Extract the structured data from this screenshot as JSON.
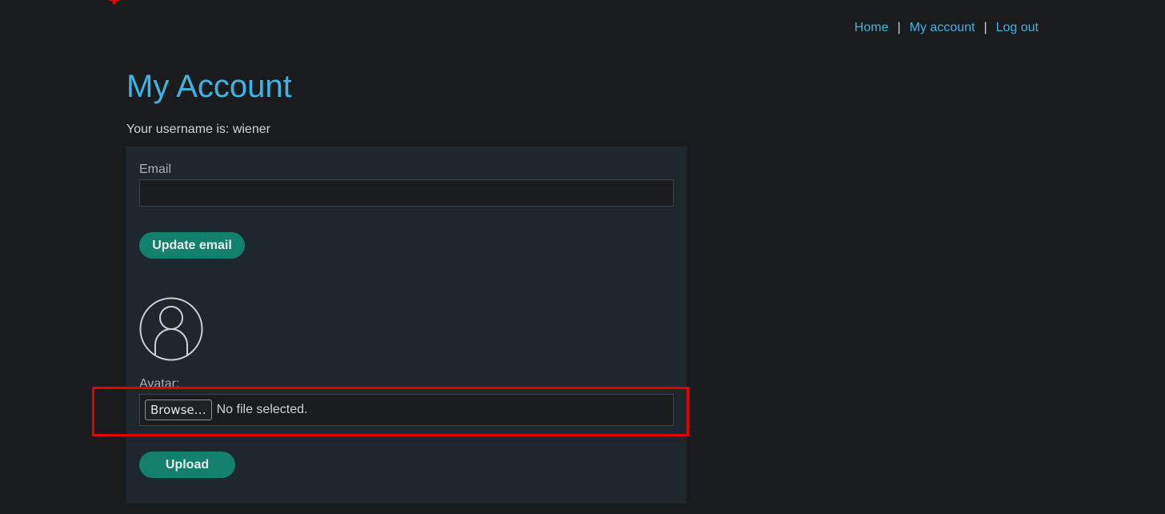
{
  "nav": {
    "home": "Home",
    "separator_1": "|",
    "my_account": "My account",
    "separator_2": "|",
    "log_out": "Log out"
  },
  "page": {
    "title": "My Account",
    "username_line": "Your username is: wiener"
  },
  "email_form": {
    "label": "Email",
    "value": "",
    "button": "Update email"
  },
  "avatar_form": {
    "avatar_icon": "user-avatar-icon",
    "label": "Avatar:",
    "browse_button": "Browse…",
    "file_status": "No file selected.",
    "button": "Upload"
  },
  "colors": {
    "background": "#1a1b1d",
    "panel": "#1d272c",
    "link": "#3db4e8",
    "button": "#12806a",
    "highlight": "#e50000"
  }
}
